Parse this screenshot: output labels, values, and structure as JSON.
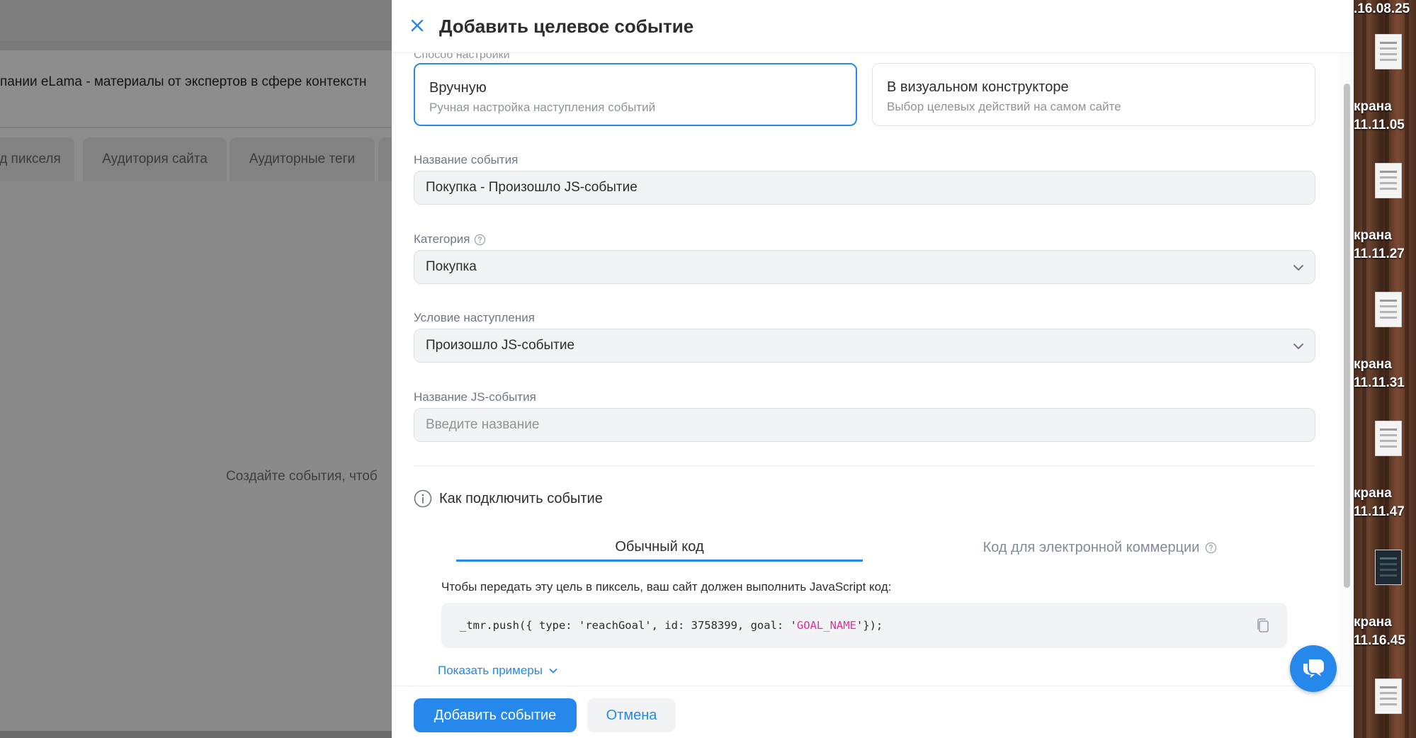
{
  "background": {
    "crumb_text": "пании eLama - материалы от экспертов в сфере контекстн",
    "tabs": [
      "д пикселя",
      "Аудитория сайта",
      "Аудиторные теги"
    ],
    "hint_text": "Создайте события, чтоб"
  },
  "modal": {
    "title": "Добавить целевое событие",
    "hidden_label": "Способ настройки",
    "modes": [
      {
        "title": "Вручную",
        "subtitle": "Ручная настройка наступления событий",
        "selected": true
      },
      {
        "title": "В визуальном конструкторе",
        "subtitle": "Выбор целевых действий на самом сайте",
        "selected": false
      }
    ],
    "fields": {
      "event_name": {
        "label": "Название события",
        "value": "Покупка - Произошло JS-событие"
      },
      "category": {
        "label": "Категория",
        "value": "Покупка"
      },
      "condition": {
        "label": "Условие наступления",
        "value": "Произошло JS-событие"
      },
      "js_event_name": {
        "label": "Название JS-события",
        "placeholder": "Введите название"
      }
    },
    "howto": {
      "title": "Как подключить событие",
      "tabs": [
        {
          "label": "Обычный код",
          "active": true
        },
        {
          "label": "Код для электронной коммерции",
          "active": false
        }
      ],
      "instruction": "Чтобы передать эту цель в пиксель, ваш сайт должен выполнить JavaScript код:",
      "code_before": "_tmr.push({ type: 'reachGoal', id: 3758399, goal: '",
      "code_goal": "GOAL_NAME",
      "code_after": "'});",
      "show_examples": "Показать примеры"
    },
    "footer": {
      "primary": "Добавить событие",
      "secondary": "Отмена"
    },
    "accent_color": "#2688eb"
  },
  "desktop": {
    "time": ".16.08.25",
    "items": [
      "крана\n11.11.05",
      "крана\n11.11.27",
      "крана\n11.11.31",
      "крана\n11.11.47",
      "крана\n11.16.45"
    ]
  }
}
